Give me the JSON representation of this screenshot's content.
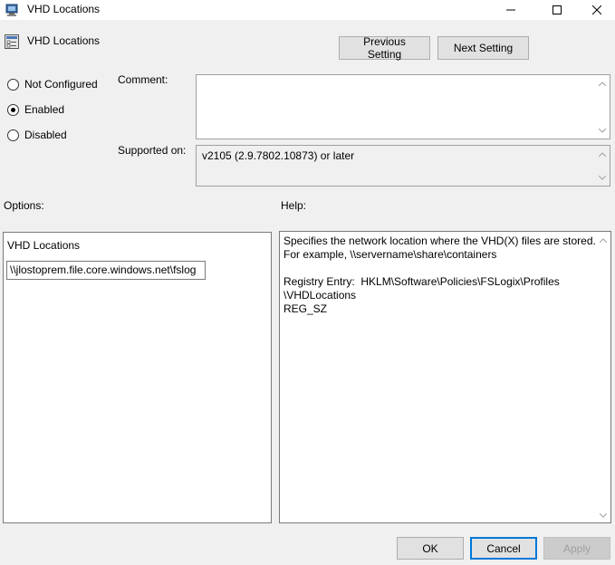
{
  "window": {
    "title": "VHD Locations"
  },
  "policy": {
    "name": "VHD Locations"
  },
  "nav": {
    "previous_label": "Previous Setting",
    "next_label": "Next Setting"
  },
  "state": {
    "options": [
      {
        "label": "Not Configured",
        "checked": false
      },
      {
        "label": "Enabled",
        "checked": true
      },
      {
        "label": "Disabled",
        "checked": false
      }
    ]
  },
  "comment": {
    "label": "Comment:",
    "value": ""
  },
  "supported": {
    "label": "Supported on:",
    "value": "v2105 (2.9.7802.10873) or later"
  },
  "options_section": {
    "label": "Options:",
    "field_label": "VHD Locations",
    "field_value": "\\\\jlostoprem.file.core.windows.net\\fslog"
  },
  "help_section": {
    "label": "Help:",
    "lines": [
      "Specifies the network location where the VHD(X) files are stored.",
      "For example, \\\\servername\\share\\containers",
      "",
      "Registry Entry:  HKLM\\Software\\Policies\\FSLogix\\Profiles",
      "\\VHDLocations",
      "REG_SZ"
    ]
  },
  "footer": {
    "ok_label": "OK",
    "cancel_label": "Cancel",
    "apply_label": "Apply"
  },
  "colors": {
    "accent": "#0078d7",
    "background": "#f0f0f0"
  }
}
